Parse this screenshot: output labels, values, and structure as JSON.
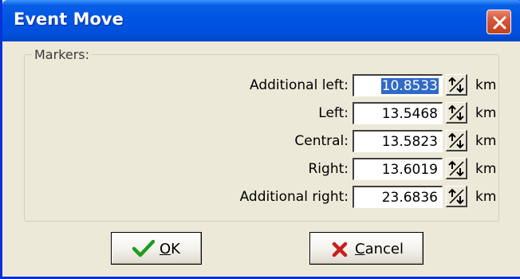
{
  "window": {
    "title": "Event Move",
    "close_icon": "close-x-icon"
  },
  "group": {
    "label": "Markers:"
  },
  "rows": [
    {
      "label": "Additional left:",
      "value": "10.8533",
      "unit": "km",
      "selected": true
    },
    {
      "label": "Left:",
      "value": "13.5468",
      "unit": "km",
      "selected": false
    },
    {
      "label": "Central:",
      "value": "13.5823",
      "unit": "km",
      "selected": false
    },
    {
      "label": "Right:",
      "value": "13.6019",
      "unit": "km",
      "selected": false
    },
    {
      "label": "Additional right:",
      "value": "23.6836",
      "unit": "km",
      "selected": false
    }
  ],
  "buttons": {
    "ok": {
      "accel": "O",
      "rest": "K",
      "icon": "checkmark-icon"
    },
    "cancel": {
      "accel": "C",
      "rest": "ancel",
      "icon": "x-mark-icon"
    }
  },
  "colors": {
    "titlebar": "#0054E3",
    "selection": "#316AC5",
    "close_button": "#D7573A",
    "ok_check": "#1E9B1E",
    "cancel_x": "#C81E1E"
  }
}
